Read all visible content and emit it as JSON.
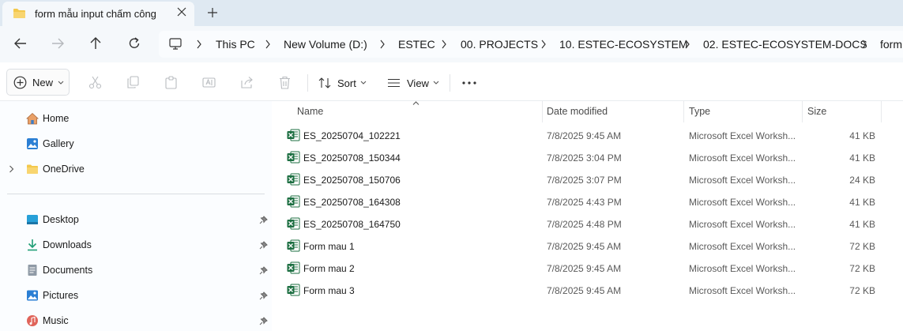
{
  "window": {
    "tab_title": "form mẫu input chấm công"
  },
  "address_bar": {
    "crumbs": [
      "This PC",
      "New Volume (D:)",
      "ESTEC",
      "00. PROJECTS",
      "10. ESTEC-ECOSYSTEM",
      "02. ESTEC-ECOSYSTEM-DOCS",
      "form"
    ]
  },
  "command_bar": {
    "new_label": "New",
    "sort_label": "Sort",
    "view_label": "View"
  },
  "sidebar": {
    "items": [
      {
        "label": "Home",
        "icon": "home-icon"
      },
      {
        "label": "Gallery",
        "icon": "gallery-icon"
      },
      {
        "label": "OneDrive",
        "icon": "onedrive-folder-icon"
      },
      {
        "label": "Desktop",
        "icon": "desktop-icon"
      },
      {
        "label": "Downloads",
        "icon": "downloads-icon"
      },
      {
        "label": "Documents",
        "icon": "documents-icon"
      },
      {
        "label": "Pictures",
        "icon": "pictures-icon"
      },
      {
        "label": "Music",
        "icon": "music-icon"
      }
    ]
  },
  "file_list": {
    "columns": {
      "name": "Name",
      "date": "Date modified",
      "type": "Type",
      "size": "Size"
    },
    "rows": [
      {
        "name": "ES_20250704_102221",
        "date": "7/8/2025 9:45 AM",
        "type": "Microsoft Excel Worksh...",
        "size": "41 KB"
      },
      {
        "name": "ES_20250708_150344",
        "date": "7/8/2025 3:04 PM",
        "type": "Microsoft Excel Worksh...",
        "size": "41 KB"
      },
      {
        "name": "ES_20250708_150706",
        "date": "7/8/2025 3:07 PM",
        "type": "Microsoft Excel Worksh...",
        "size": "24 KB"
      },
      {
        "name": "ES_20250708_164308",
        "date": "7/8/2025 4:43 PM",
        "type": "Microsoft Excel Worksh...",
        "size": "41 KB"
      },
      {
        "name": "ES_20250708_164750",
        "date": "7/8/2025 4:48 PM",
        "type": "Microsoft Excel Worksh...",
        "size": "41 KB"
      },
      {
        "name": "Form mau 1",
        "date": "7/8/2025 9:45 AM",
        "type": "Microsoft Excel Worksh...",
        "size": "72 KB"
      },
      {
        "name": "Form mau 2",
        "date": "7/8/2025 9:45 AM",
        "type": "Microsoft Excel Worksh...",
        "size": "72 KB"
      },
      {
        "name": "Form mau 3",
        "date": "7/8/2025 9:45 AM",
        "type": "Microsoft Excel Worksh...",
        "size": "72 KB"
      }
    ]
  },
  "colors": {
    "titlebar_bg": "#dfe9f2",
    "excel_green": "#1d6f42",
    "folder_yellow": "#f3c84c"
  }
}
